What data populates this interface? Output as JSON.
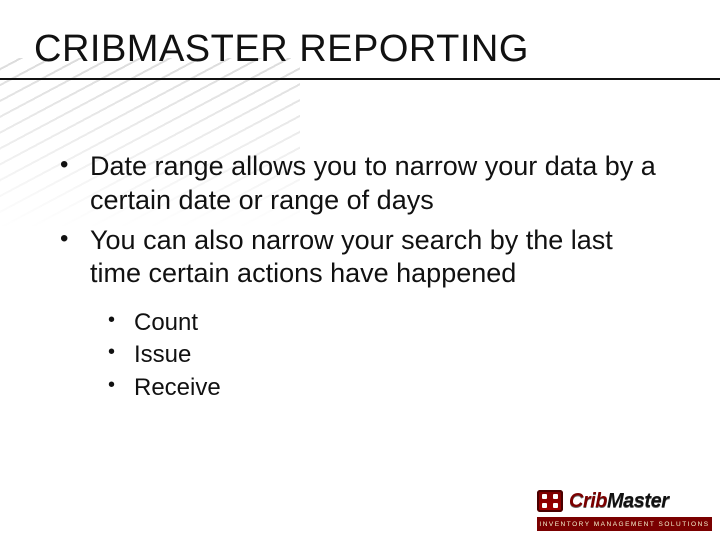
{
  "title": "CRIBMASTER REPORTING",
  "bullets": {
    "items": [
      "Date range allows you to narrow your data by a certain date or range of days",
      "You can also narrow your search by the last time certain actions have happened"
    ],
    "sub_items": [
      "Count",
      "Issue",
      "Receive"
    ]
  },
  "logo": {
    "word_prefix": "Crib",
    "word_suffix": "Master",
    "tagline": "INVENTORY MANAGEMENT SOLUTIONS"
  }
}
